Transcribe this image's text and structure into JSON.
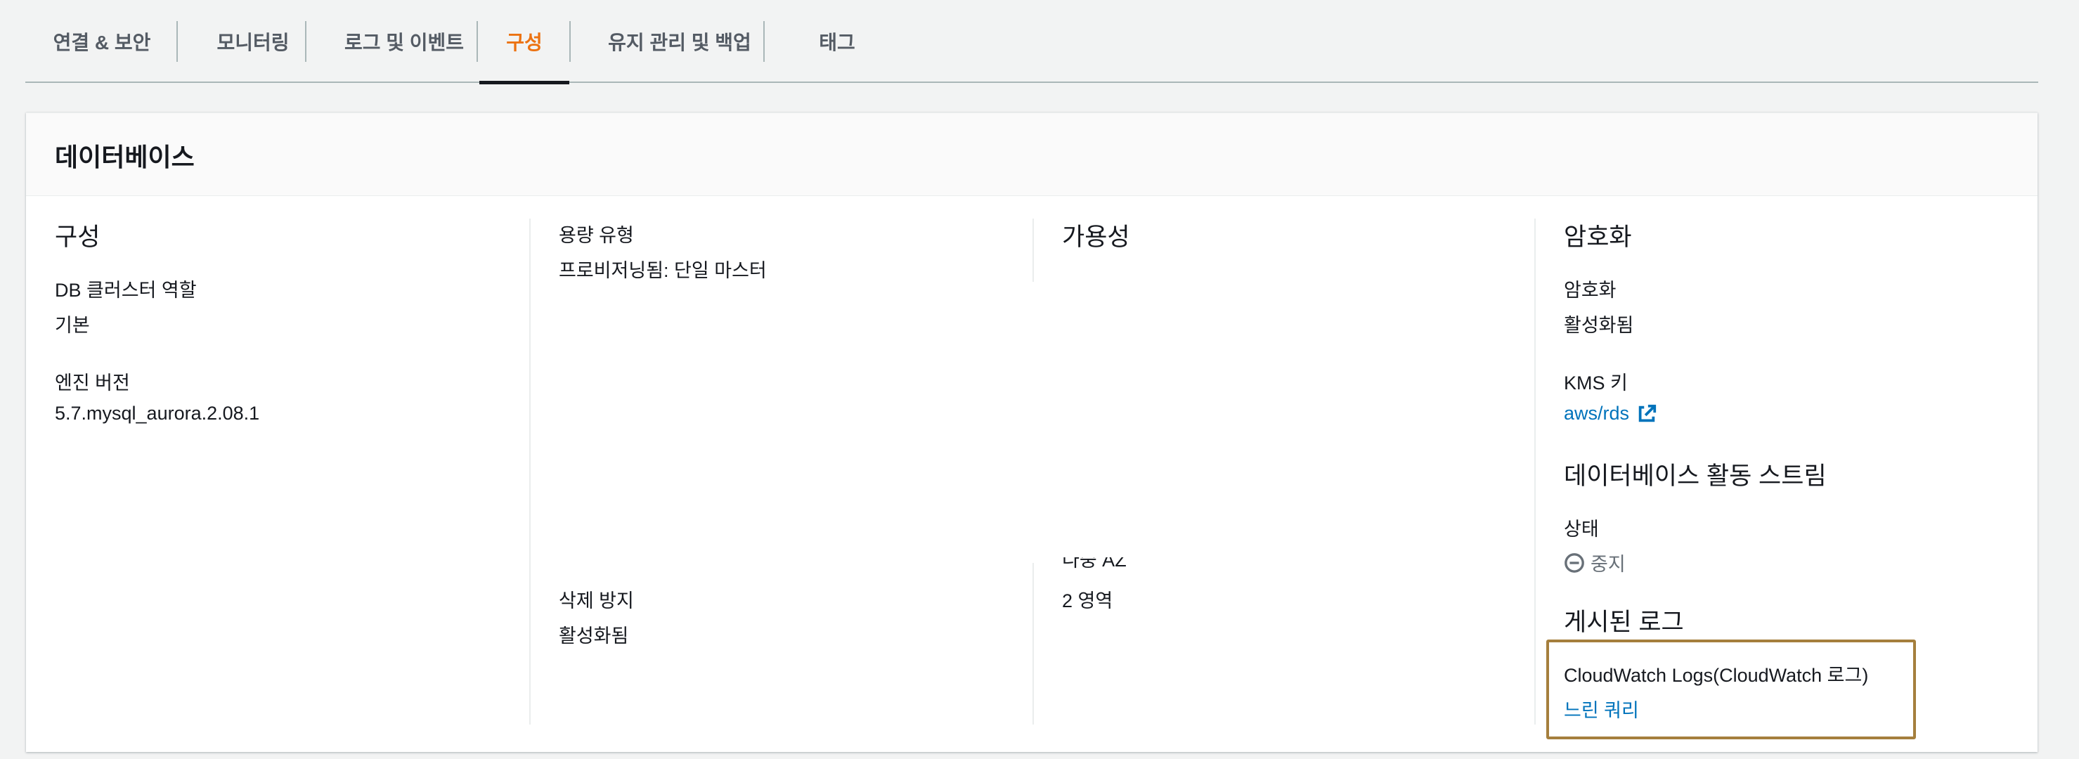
{
  "tabs": [
    {
      "label": "연결 & 보안"
    },
    {
      "label": "모니터링"
    },
    {
      "label": "로그 및 이벤트"
    },
    {
      "label": "구성"
    },
    {
      "label": "유지 관리 및 백업"
    },
    {
      "label": "태그"
    }
  ],
  "active_tab_color": "#ec7211",
  "panel": {
    "title": "데이터베이스"
  },
  "col1": {
    "heading": "구성",
    "role_label": "DB 클러스터 역할",
    "role_value": "기본",
    "engine_label": "엔진 버전",
    "engine_value": "5.7.mysql_aurora.2.08.1"
  },
  "col2": {
    "capacity_label": "용량 유형",
    "capacity_value": "프로비저닝됨: 단일 마스터",
    "deletion_label": "삭제 방지",
    "deletion_value": "활성화됨"
  },
  "col3": {
    "heading": "가용성",
    "multi_az_label": "다중 AZ",
    "multi_az_value": "2 영역"
  },
  "col4": {
    "heading": "암호화",
    "encryption_label": "암호화",
    "encryption_value": "활성화됨",
    "kms_label": "KMS 키",
    "kms_value": "aws/rds",
    "stream_heading": "데이터베이스 활동 스트림",
    "stream_status_label": "상태",
    "stream_status_value": "중지",
    "logs_heading": "게시된 로그",
    "cloudwatch_label": "CloudWatch Logs(CloudWatch 로그)",
    "slow_query_value": "느린 쿼리"
  },
  "icons": {
    "external_link": "external-link-icon",
    "stopped": "stopped-icon"
  },
  "colors": {
    "link": "#0073bb",
    "highlight_border": "#a57f3d"
  }
}
